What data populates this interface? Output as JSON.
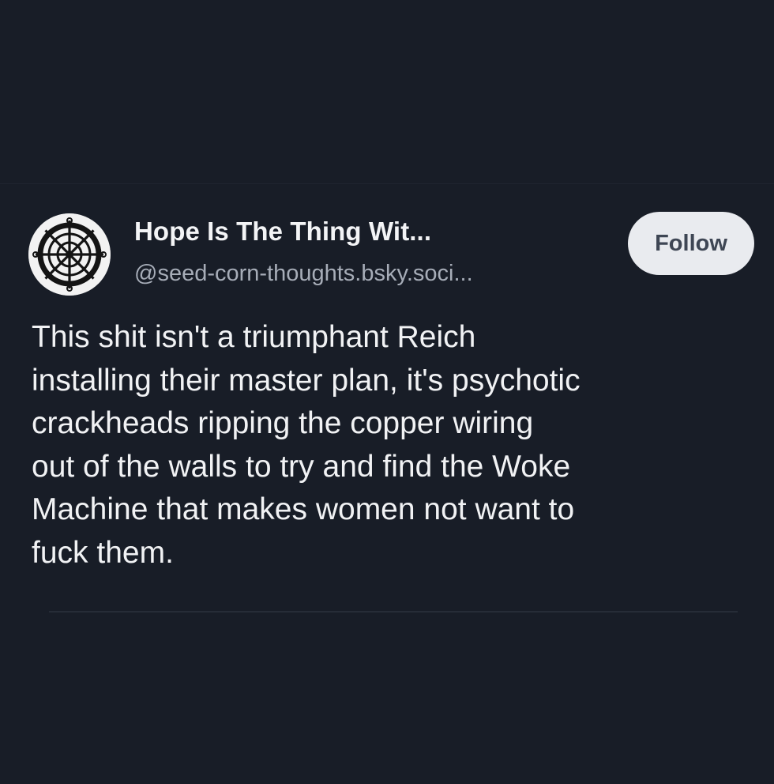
{
  "post": {
    "author": {
      "display_name": "Hope Is The Thing Wit...",
      "handle": "@seed-corn-thoughts.bsky.soci...",
      "avatar_icon": "ship-wheel-icon"
    },
    "follow_label": "Follow",
    "text_lines": [
      "This shit isn't a triumphant Reich",
      "installing their master plan, it's psychotic",
      "crackheads ripping the copper wiring",
      "out of the walls to try and find the Woke",
      "Machine that makes women not want to",
      "fuck them."
    ]
  },
  "colors": {
    "background": "#181d27",
    "text_primary": "#f1f2f4",
    "text_secondary": "#a7adb8",
    "follow_button_bg": "#e9ebef",
    "follow_button_text": "#3e4654"
  }
}
